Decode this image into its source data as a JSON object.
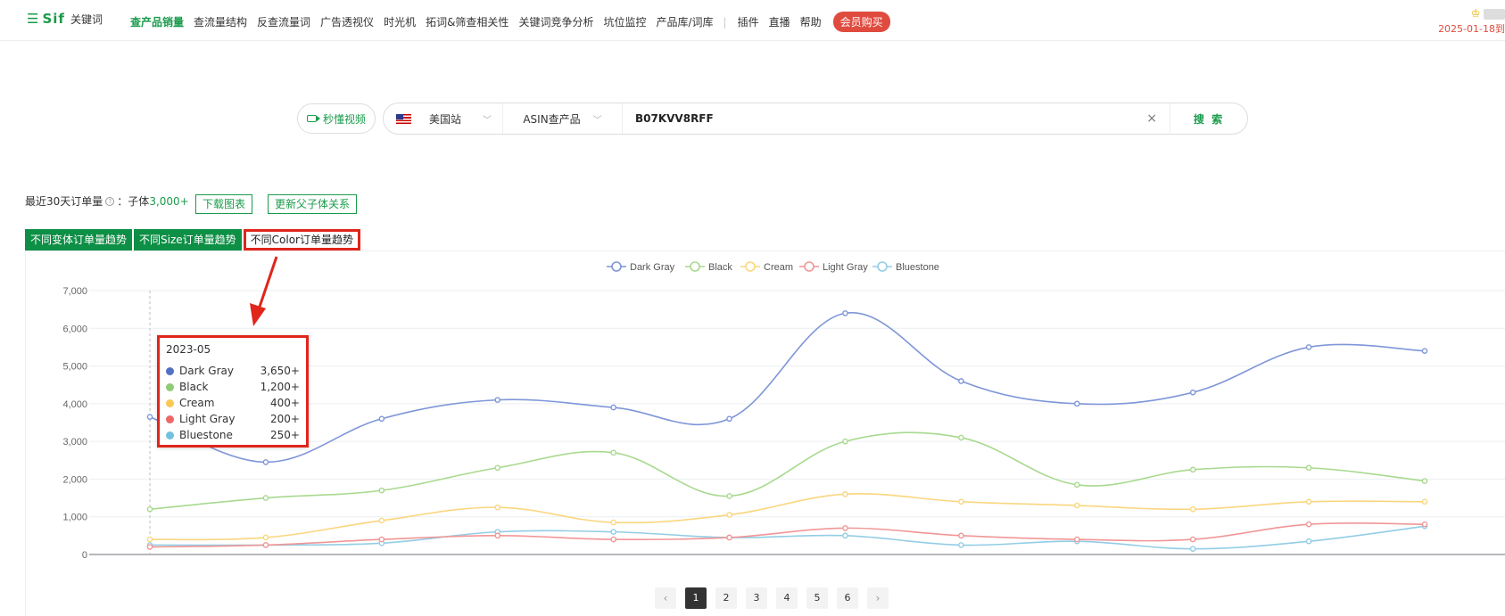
{
  "brand": {
    "logo_text": "Sif",
    "product": "关键词"
  },
  "nav": {
    "items": [
      "查产品销量",
      "查流量结构",
      "反查流量词",
      "广告透视仪",
      "时光机",
      "拓词&筛查相关性",
      "关键词竞争分析",
      "坑位监控",
      "产品库/词库"
    ],
    "separator": "|",
    "extras": [
      "插件",
      "直播",
      "帮助"
    ],
    "vip": "会员购买",
    "expire_date": "2025-01-18到"
  },
  "search": {
    "video_label": "秒懂视频",
    "site": "美国站",
    "type": "ASIN查产品",
    "value": "B07KVV8RFF",
    "clear": "×",
    "button": "搜 索"
  },
  "stats": {
    "label": "最近30天订单量",
    "info": "?",
    "sep": "：",
    "child_label": "子体",
    "child_count": "3,000+",
    "download": "下载图表",
    "update": "更新父子体关系"
  },
  "tabs": [
    "不同变体订单量趋势",
    "不同Size订单量趋势",
    "不同Color订单量趋势"
  ],
  "tooltip": {
    "title": "2023-05",
    "rows": [
      {
        "name": "Dark Gray",
        "value": "3,650+",
        "color": "#5470c6"
      },
      {
        "name": "Black",
        "value": "1,200+",
        "color": "#91cc75"
      },
      {
        "name": "Cream",
        "value": "400+",
        "color": "#fac858"
      },
      {
        "name": "Light Gray",
        "value": "200+",
        "color": "#ee6666"
      },
      {
        "name": "Bluestone",
        "value": "250+",
        "color": "#73c0de"
      }
    ]
  },
  "chart_data": {
    "type": "line",
    "smooth": true,
    "legend_position": "top-center",
    "ylim": [
      0,
      7000
    ],
    "yticks": [
      "0",
      "1,000",
      "2,000",
      "3,000",
      "4,000",
      "5,000",
      "6,000",
      "7,000"
    ],
    "ytick_values": [
      0,
      1000,
      2000,
      3000,
      4000,
      5000,
      6000,
      7000
    ],
    "n_points": 12,
    "series": [
      {
        "name": "Dark Gray",
        "color": "#7f96d8",
        "values": [
          3650,
          2450,
          3600,
          4100,
          3900,
          3600,
          6400,
          4600,
          4000,
          4300,
          5500,
          5400
        ]
      },
      {
        "name": "Black",
        "color": "#a8d98e",
        "values": [
          1200,
          1500,
          1700,
          2300,
          2700,
          1550,
          3000,
          3100,
          1850,
          2250,
          2300,
          1950
        ]
      },
      {
        "name": "Cream",
        "color": "#fad67e",
        "values": [
          400,
          450,
          900,
          1250,
          850,
          1050,
          1600,
          1400,
          1300,
          1200,
          1400,
          1400
        ]
      },
      {
        "name": "Light Gray",
        "color": "#f19696",
        "values": [
          200,
          250,
          400,
          500,
          400,
          450,
          700,
          500,
          400,
          400,
          800,
          800
        ]
      },
      {
        "name": "Bluestone",
        "color": "#93cde5",
        "values": [
          250,
          250,
          300,
          600,
          600,
          450,
          500,
          250,
          350,
          150,
          350,
          750
        ]
      }
    ]
  },
  "pagination": {
    "prev": "‹",
    "next": "›",
    "pages": [
      "1",
      "2",
      "3",
      "4",
      "5",
      "6"
    ],
    "current": "1"
  }
}
